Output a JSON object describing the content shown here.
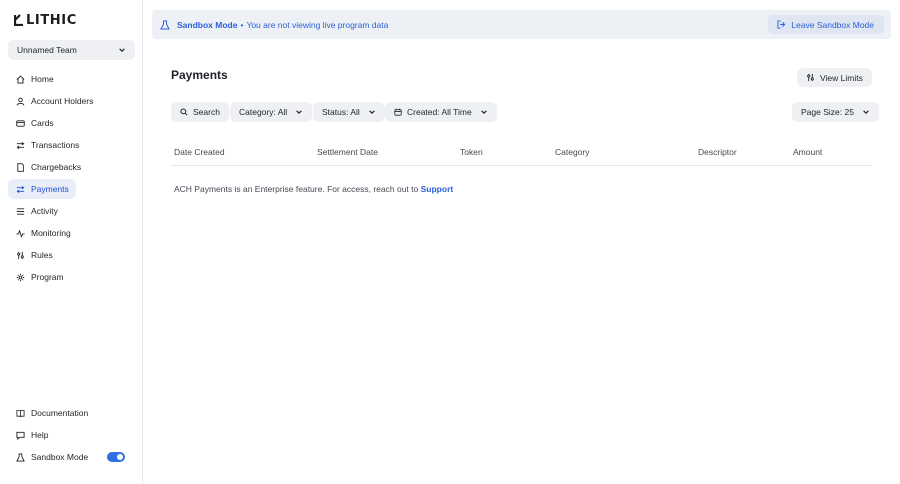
{
  "brand": {
    "logo_text": "LITHIC"
  },
  "team": {
    "selected": "Unnamed Team"
  },
  "sidebar": {
    "items": [
      {
        "label": "Home",
        "icon": "home-icon"
      },
      {
        "label": "Account Holders",
        "icon": "user-icon"
      },
      {
        "label": "Cards",
        "icon": "card-icon"
      },
      {
        "label": "Transactions",
        "icon": "transactions-icon"
      },
      {
        "label": "Chargebacks",
        "icon": "document-icon"
      },
      {
        "label": "Payments",
        "icon": "payments-icon",
        "active": true
      },
      {
        "label": "Activity",
        "icon": "activity-icon"
      },
      {
        "label": "Monitoring",
        "icon": "monitoring-icon"
      },
      {
        "label": "Rules",
        "icon": "rules-icon"
      },
      {
        "label": "Program",
        "icon": "gear-icon"
      }
    ],
    "bottom": [
      {
        "label": "Documentation",
        "icon": "book-icon"
      },
      {
        "label": "Help",
        "icon": "help-icon"
      },
      {
        "label": "Sandbox Mode",
        "icon": "beaker-icon",
        "toggle_on": true
      }
    ]
  },
  "banner": {
    "mode": "Sandbox Mode",
    "separator": "•",
    "message": "You are not viewing live program data",
    "leave_label": "Leave Sandbox Mode"
  },
  "page": {
    "title": "Payments",
    "view_limits_label": "View Limits"
  },
  "filters": {
    "search_label": "Search",
    "category": "Category: All",
    "status": "Status: All",
    "created": "Created: All Time",
    "page_size": "Page Size: 25"
  },
  "table": {
    "columns": [
      "Date Created",
      "Settlement Date",
      "Token",
      "Category",
      "Descriptor",
      "Amount"
    ]
  },
  "notice": {
    "text": "ACH Payments is an Enterprise feature. For access, reach out to",
    "link": "Support"
  },
  "colors": {
    "accent": "#2b5fd9",
    "toggle": "#2f6fe4",
    "pill_bg": "#eef0f3",
    "banner_bg": "#edf1f6"
  }
}
